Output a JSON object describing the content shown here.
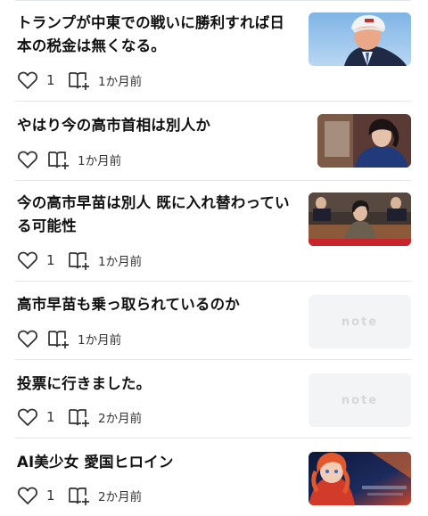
{
  "articles": [
    {
      "title": "トランプが中東での戦いに勝利すれば日本の税金は無くなる。",
      "likes": "1",
      "date": "1か月前",
      "thumb": "photo",
      "thumb_name": "trump-photo"
    },
    {
      "title": "やはり今の高市首相は別人か",
      "likes": "",
      "date": "1か月前",
      "thumb": "photo",
      "thumb_name": "takaichi-photo"
    },
    {
      "title": "今の高市早苗は別人 既に入れ替わっている可能性",
      "likes": "1",
      "date": "1か月前",
      "thumb": "photo",
      "thumb_name": "diet-session-photo"
    },
    {
      "title": "高市早苗も乗っ取られているのか",
      "likes": "",
      "date": "1か月前",
      "thumb": "note",
      "thumb_name": "note-placeholder"
    },
    {
      "title": "投票に行きました。",
      "likes": "1",
      "date": "2か月前",
      "thumb": "note",
      "thumb_name": "note-placeholder"
    },
    {
      "title": "AI美少女 愛国ヒロイン",
      "likes": "1",
      "date": "2か月前",
      "thumb": "photo",
      "thumb_name": "anime-heroine-image"
    }
  ],
  "placeholder_logo": "note",
  "icons": {
    "like": "heart-icon",
    "save": "bookmark-add-icon"
  },
  "colors": {
    "text": "#111111",
    "meta": "#333333",
    "divider": "#e3e6e8",
    "placeholder": "#f3f4f5"
  }
}
